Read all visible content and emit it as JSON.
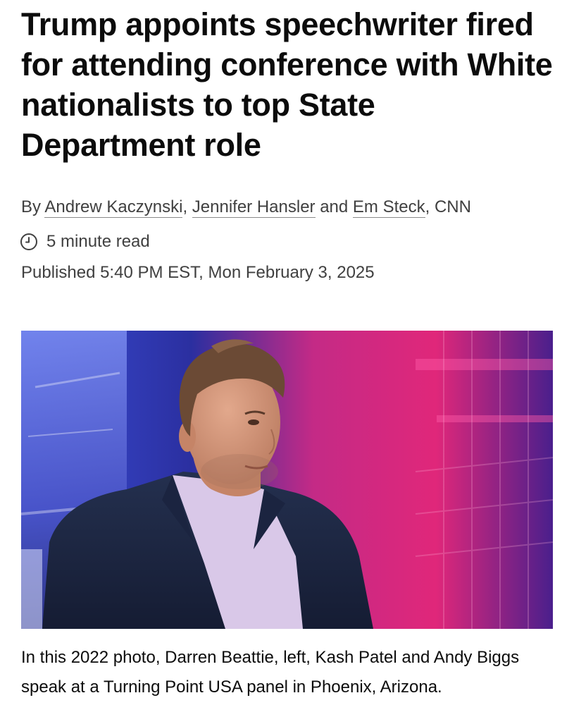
{
  "article": {
    "headline": "Trump appoints speechwriter fired for attending conference with White nationalists to top State Department role",
    "byline": {
      "prefix": "By ",
      "authors": [
        "Andrew Kaczynski",
        "Jennifer Hansler",
        "Em Steck"
      ],
      "sep1": ", ",
      "sep2": " and ",
      "suffix": ", CNN"
    },
    "read_time": "5 minute read",
    "published": "Published 5:40 PM EST, Mon February 3, 2025",
    "image": {
      "caption": "In this 2022 photo, Darren Beattie, left, Kash Patel and Andy Biggs speak at a Turning Point USA panel in Phoenix, Arizona."
    }
  },
  "icons": {
    "read_time": "clock-icon"
  },
  "colors": {
    "headline": "#0c0c0c",
    "meta_text": "#404040"
  }
}
